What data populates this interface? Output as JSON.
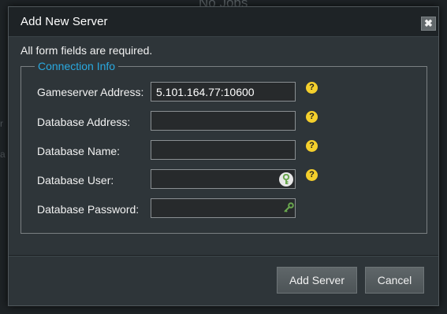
{
  "backdrop": {
    "heading_fragment": "No Jobs"
  },
  "dialog": {
    "title": "Add New Server",
    "close_label": "✖",
    "required_note": "All form fields are required."
  },
  "connection_info": {
    "legend": "Connection Info",
    "fields": [
      {
        "label": "Gameserver Address:",
        "value": "5.101.164.77:10600",
        "placeholder": "",
        "help": "?"
      },
      {
        "label": "Database Address:",
        "value": "",
        "placeholder": "",
        "help": "?"
      },
      {
        "label": "Database Name:",
        "value": "",
        "placeholder": "",
        "help": "?"
      },
      {
        "label": "Database User:",
        "value": "",
        "placeholder": "",
        "help": "?",
        "icon": "key-icon"
      },
      {
        "label": "Database Password:",
        "value": "",
        "placeholder": "",
        "icon": "key-icon"
      }
    ]
  },
  "buttons": {
    "add_label": "Add Server",
    "cancel_label": "Cancel"
  },
  "colors": {
    "accent": "#29a9e0",
    "help_icon": "#f4cf2c",
    "key_icon": "#6aa84f",
    "dialog_bg": "#2e3539",
    "titlebar_bg": "#1e2326"
  }
}
